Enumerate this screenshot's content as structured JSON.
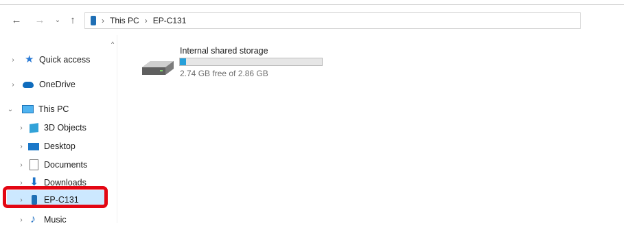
{
  "breadcrumb": {
    "items": [
      "This PC",
      "EP-C131"
    ]
  },
  "navigation": {
    "items": [
      {
        "label": "Quick access"
      },
      {
        "label": "OneDrive"
      },
      {
        "label": "This PC"
      },
      {
        "label": "3D Objects"
      },
      {
        "label": "Desktop"
      },
      {
        "label": "Documents"
      },
      {
        "label": "Downloads"
      },
      {
        "label": "EP-C131"
      },
      {
        "label": "Music"
      }
    ],
    "selected": "EP-C131"
  },
  "drive": {
    "name": "Internal shared storage",
    "free_text": "2.74 GB free of 2.86 GB",
    "used_fraction": 0.042
  },
  "colors": {
    "highlight": "#e30613",
    "selection": "#cce8ff",
    "accent": "#26a0da"
  },
  "icons": {
    "back": "arrow-left-icon",
    "forward": "arrow-right-icon",
    "recent": "chevron-down-icon",
    "up": "arrow-up-icon",
    "device": "phone-icon"
  }
}
